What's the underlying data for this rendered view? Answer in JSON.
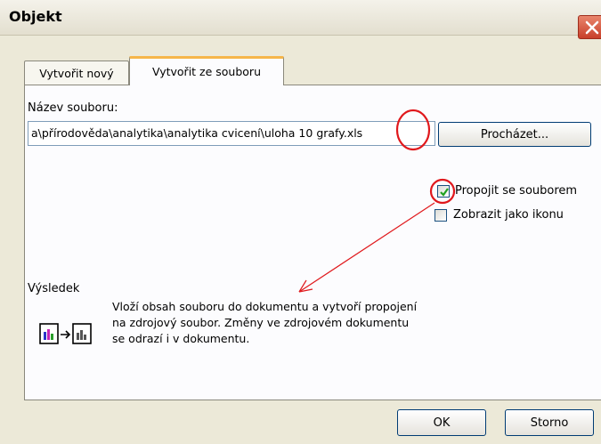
{
  "window": {
    "title": "Objekt",
    "close_icon": "close-icon"
  },
  "tabs": [
    {
      "label": "Vytvořit nový",
      "selected": false
    },
    {
      "label": "Vytvořit ze souboru",
      "selected": true
    }
  ],
  "file": {
    "label": "Název souboru:",
    "path_value": "a\\přírodověda\\analytika\\analytika cvicení\\uloha 10 grafy.xls",
    "browse_label": "Procházet..."
  },
  "options": {
    "link_label": "Propojit se souborem",
    "link_checked": true,
    "icon_label": "Zobrazit jako ikonu",
    "icon_checked": false
  },
  "result": {
    "heading": "Výsledek",
    "description": "Vloží obsah souboru do dokumentu a vytvoří propojení na zdrojový soubor. Změny ve zdrojovém dokumentu se odrazí i v dokumentu."
  },
  "footer": {
    "ok_label": "OK",
    "cancel_label": "Storno"
  },
  "annotation_color": "#e0181c"
}
